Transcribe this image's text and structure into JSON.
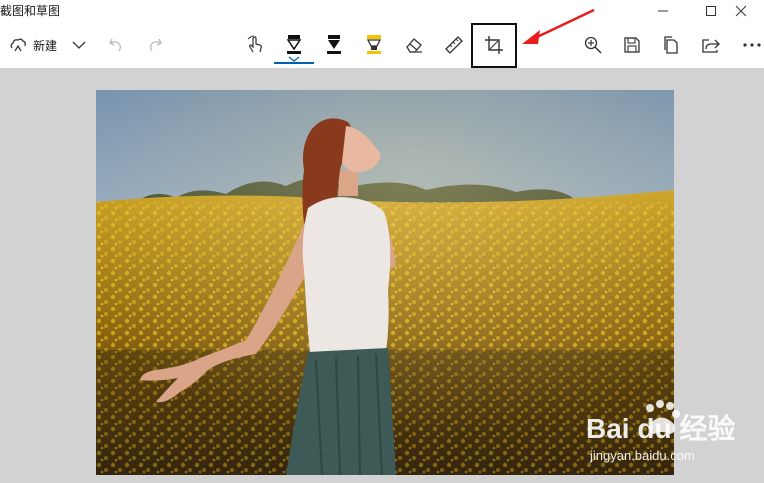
{
  "app": {
    "title": "截图和草图"
  },
  "window_controls": [
    "minimize-icon",
    "maximize-icon",
    "close-icon"
  ],
  "toolbar": {
    "new_label": "新建",
    "tools": [
      "touch-writing-icon",
      "ballpoint-pen-icon",
      "pencil-icon",
      "highlighter-icon",
      "eraser-icon",
      "ruler-icon",
      "crop-icon"
    ],
    "right_tools": [
      "zoom-icon",
      "save-icon",
      "copy-icon",
      "share-icon",
      "more-icon"
    ],
    "active_tool": "ballpoint-pen",
    "accent_color": "#0063b1",
    "highlight_tool": "crop",
    "annotation_arrow_color": "#e81e1e"
  },
  "watermark": {
    "brand": "Bai du 经验",
    "url": "jingyan.baidu.com"
  }
}
